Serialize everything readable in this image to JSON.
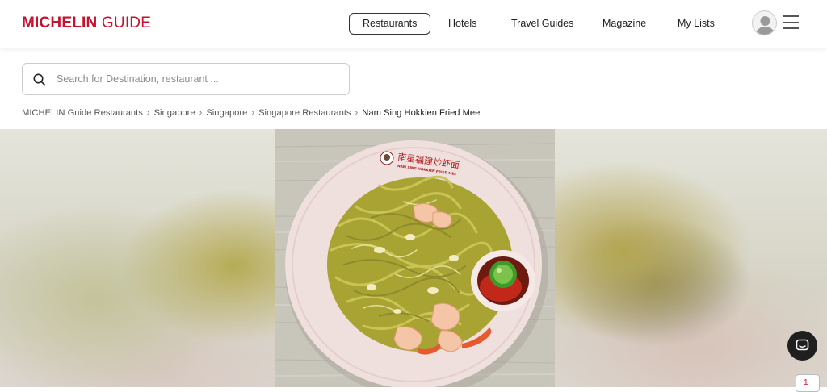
{
  "header": {
    "logo_brand": "MICHELIN",
    "logo_guide": "GUIDE",
    "nav": [
      {
        "label": "Restaurants",
        "active": true
      },
      {
        "label": "Hotels",
        "active": false
      },
      {
        "label": "Travel Guides",
        "active": false
      },
      {
        "label": "Magazine",
        "active": false
      },
      {
        "label": "My Lists",
        "active": false
      }
    ]
  },
  "search": {
    "placeholder": "Search for Destination, restaurant ..."
  },
  "breadcrumbs": [
    "MICHELIN Guide Restaurants",
    "Singapore",
    "Singapore",
    "Singapore Restaurants",
    "Nam Sing Hokkien Fried Mee"
  ],
  "breadcrumb_separator": "›",
  "plate_text": {
    "chinese": "南星福建炒虾面",
    "english": "NAM SING HOKKIEN FRIED MEE"
  },
  "colors": {
    "brand_red": "#c4122f",
    "text_dark": "#222222"
  },
  "floating": {
    "badge_count": "1"
  }
}
